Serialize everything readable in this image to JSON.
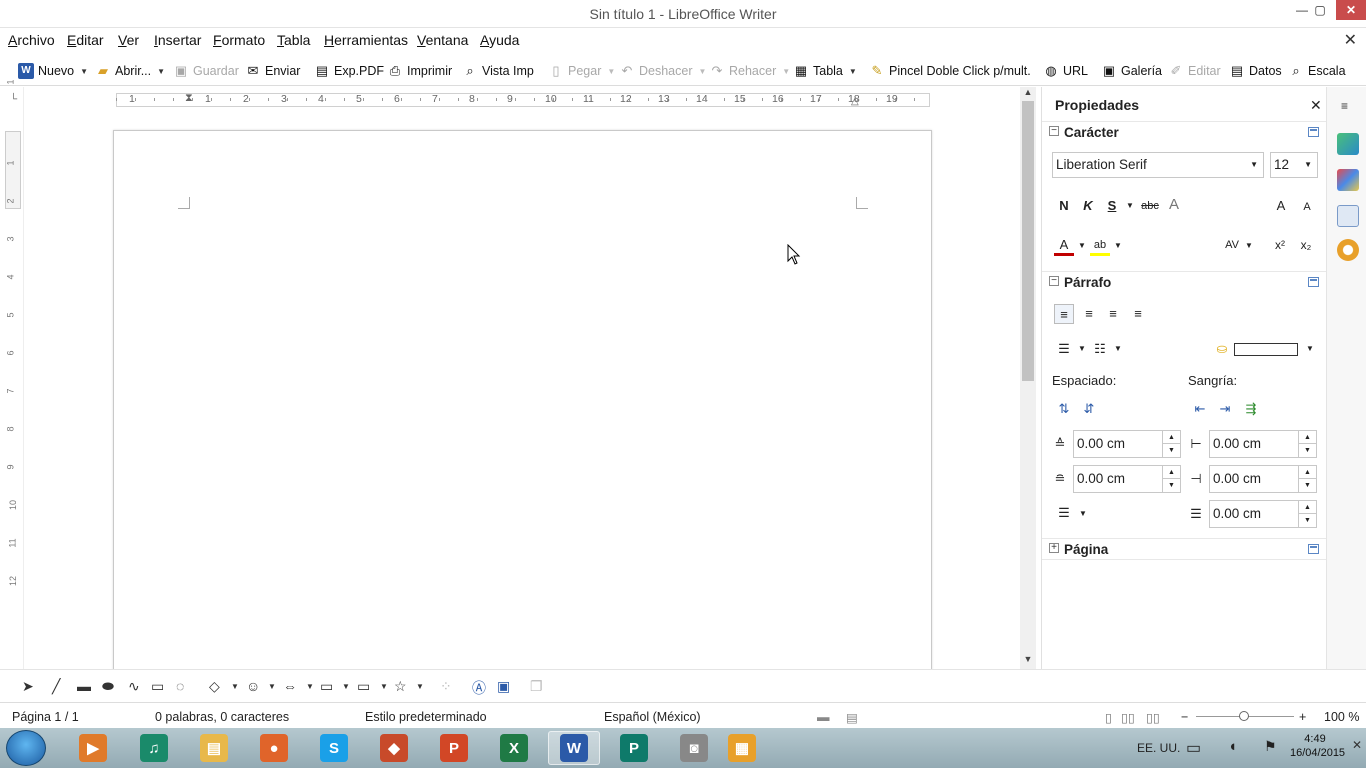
{
  "window": {
    "title": "Sin título 1 - LibreOffice Writer",
    "minimize": "—",
    "maximize": "▢",
    "close": "✕"
  },
  "menubar": {
    "items": [
      {
        "underline": "A",
        "rest": "rchivo"
      },
      {
        "underline": "E",
        "rest": "ditar"
      },
      {
        "underline": "V",
        "rest": "er"
      },
      {
        "underline": "I",
        "rest": "nsertar"
      },
      {
        "underline": "F",
        "rest": "ormato"
      },
      {
        "underline": "T",
        "rest": "abla"
      },
      {
        "underline": "H",
        "rest": "erramientas"
      },
      {
        "underline": "V",
        "rest": "entana"
      },
      {
        "underline": "A",
        "rest": "yuda"
      }
    ],
    "close_doc": "✕"
  },
  "toolbar": {
    "nuevo": "Nuevo",
    "abrir": "Abrir...",
    "guardar": "Guardar",
    "enviar": "Enviar",
    "exp_pdf": "Exp.PDF",
    "imprimir": "Imprimir",
    "vista_imp": "Vista Imp",
    "pegar": "Pegar",
    "deshacer": "Deshacer",
    "rehacer": "Rehacer",
    "tabla": "Tabla",
    "pincel": "Pincel Doble Click p/mult.",
    "url": "URL",
    "galeria": "Galería",
    "editar": "Editar",
    "datos": "Datos",
    "escala": "Escala"
  },
  "ruler": {
    "numbers": [
      "1",
      "1",
      "2",
      "3",
      "4",
      "5",
      "6",
      "7",
      "8",
      "9",
      "10",
      "11",
      "12",
      "13",
      "14",
      "15",
      "16",
      "17",
      "18",
      "19"
    ],
    "vertical_numbers": [
      "1",
      "1",
      "2",
      "3",
      "4",
      "5",
      "6",
      "7",
      "8",
      "9",
      "10",
      "11",
      "12"
    ]
  },
  "sidebar": {
    "title": "Propiedades",
    "close": "✕",
    "caracter": {
      "header": "Carácter",
      "font_name": "Liberation Serif",
      "font_size": "12",
      "bold": "N",
      "italic": "K",
      "underline": "S",
      "strike": "abc",
      "shadow": "A",
      "grow": "A",
      "shrink": "A",
      "font_color": "A",
      "highlight": "ab",
      "spacing": "AV",
      "superscript": "x²",
      "subscript": "x₂"
    },
    "parrafo": {
      "header": "Párrafo",
      "espaciado_label": "Espaciado:",
      "sangria_label": "Sangría:",
      "above_spacing": "0.00 cm",
      "below_spacing": "0.00 cm",
      "before_indent": "0.00 cm",
      "after_indent": "0.00 cm",
      "first_line_indent": "0.00 cm"
    },
    "pagina": {
      "header": "Página"
    }
  },
  "statusbar": {
    "page": "Página 1 / 1",
    "words": "0 palabras, 0 caracteres",
    "style": "Estilo predeterminado",
    "language": "Español (México)",
    "zoom": "100 %",
    "zoom_level": 100,
    "zoom_minus": "−",
    "zoom_plus": "+"
  },
  "taskbar": {
    "language": "EE. UU.",
    "time": "4:49",
    "date": "16/04/2015",
    "apps": [
      {
        "name": "media-player",
        "glyph": "▶",
        "color": "#e07a2a"
      },
      {
        "name": "headphones",
        "glyph": "♫",
        "color": "#1a8a6a"
      },
      {
        "name": "file-explorer",
        "glyph": "▤",
        "color": "#e8b84a"
      },
      {
        "name": "firefox",
        "glyph": "●",
        "color": "#e0642a"
      },
      {
        "name": "skype",
        "glyph": "S",
        "color": "#1aa0e8"
      },
      {
        "name": "video-editor",
        "glyph": "◆",
        "color": "#c84a2a"
      },
      {
        "name": "powerpoint",
        "glyph": "P",
        "color": "#d24726"
      },
      {
        "name": "excel",
        "glyph": "X",
        "color": "#1f7a45"
      },
      {
        "name": "word",
        "glyph": "W",
        "color": "#2b5aa8"
      },
      {
        "name": "publisher",
        "glyph": "P",
        "color": "#0e7a6a"
      },
      {
        "name": "camera",
        "glyph": "◙",
        "color": "#888888"
      },
      {
        "name": "office-tools",
        "glyph": "▦",
        "color": "#e8a02a"
      }
    ]
  },
  "colors": {
    "accent": "#2b5aa8",
    "font_color_bar": "#c00000",
    "highlight_bar": "#ffff00"
  }
}
